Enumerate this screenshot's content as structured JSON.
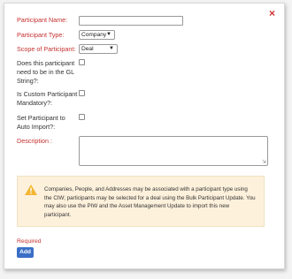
{
  "dialog": {
    "close_icon": "×",
    "fields": {
      "participant_name_label": "Participant Name:",
      "participant_type_label": "Participant Type:",
      "participant_type_value": "Company",
      "scope_label": "Scope of Participant:",
      "scope_value": "Deal",
      "gl_string_label_1": "Does this participant",
      "gl_string_label_2": "need to be in the GL",
      "gl_string_label_3": "String?:",
      "custom_mandatory_label_1": "Is Custom Participant",
      "custom_mandatory_label_2": "Mandatory?:",
      "auto_import_label_1": "Set Participant to",
      "auto_import_label_2": "Auto Import?:",
      "description_label": "Description :"
    },
    "notice": {
      "icon": "warning-triangle",
      "text": "Companies, People, and Addresses may be associated with a participant type using the CIW; participants may be selected for a deal using the Bulk Participant Update. You may also use the PIW and the Asset Management Update to import this new participant."
    },
    "required_text": "Required",
    "add_button": "Add"
  },
  "colors": {
    "required_red": "#c53030",
    "notice_bg": "#fdf1dc",
    "button_blue": "#3a6fc7",
    "warning_yellow": "#f2b632"
  }
}
